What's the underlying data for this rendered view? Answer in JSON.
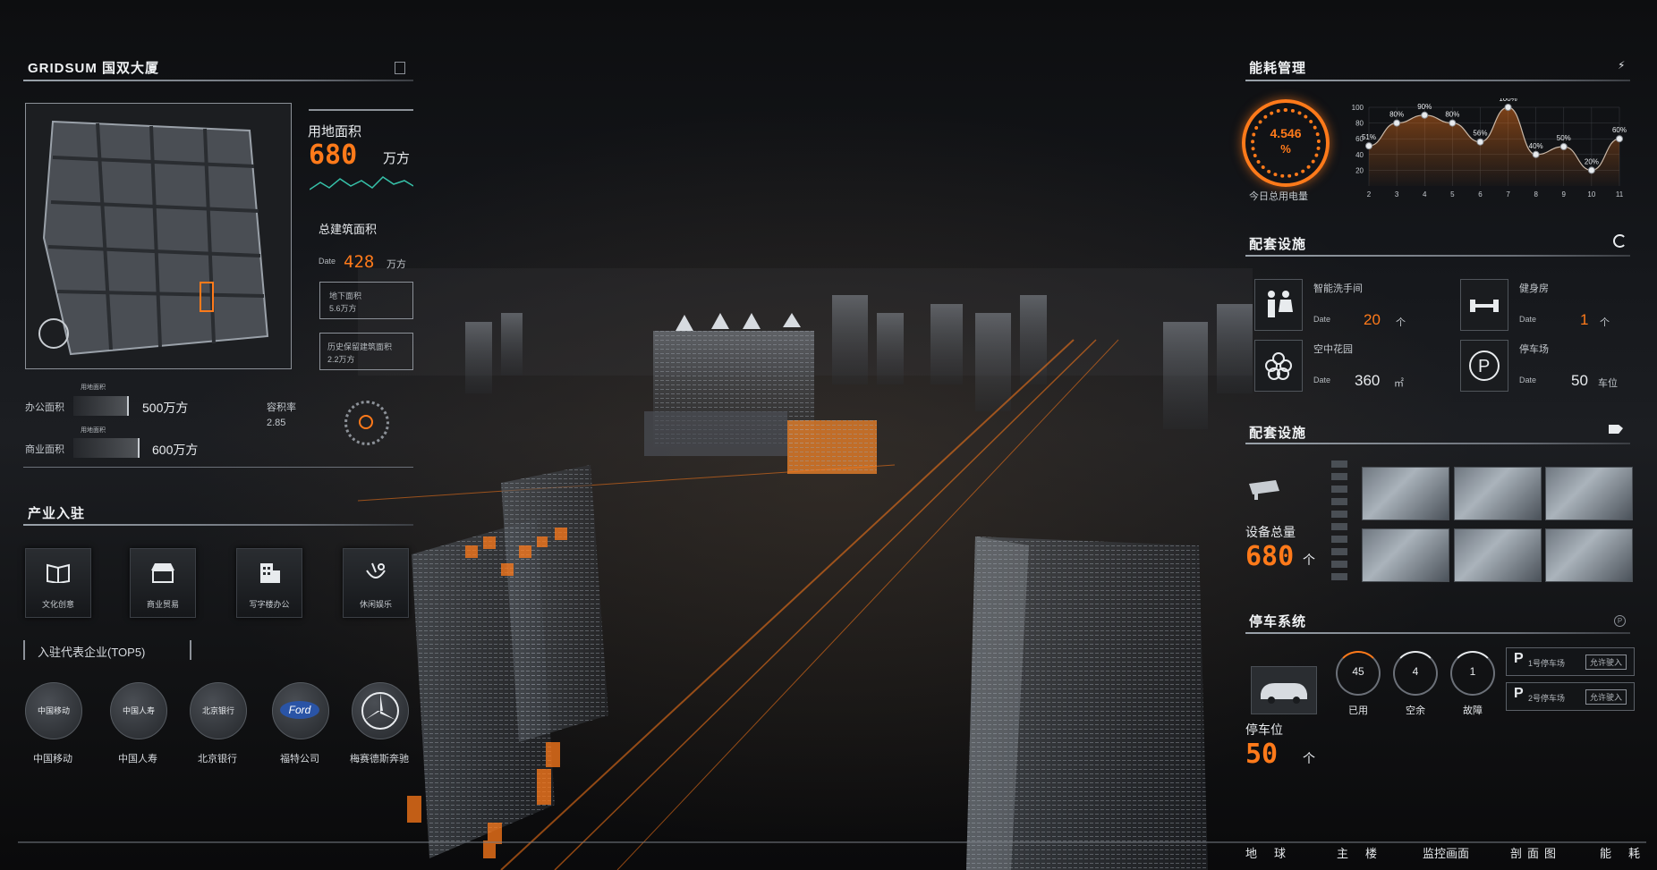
{
  "header": {
    "title": "GRIDSUM 国双大厦"
  },
  "land": {
    "label": "用地面积",
    "value": "680",
    "unit": "万方",
    "build_label": "总建筑面积",
    "date_label": "Date",
    "build_value": "428",
    "build_unit": "万方",
    "underground_label": "地下面积",
    "underground_value": "5.6万方",
    "heritage_label": "历史保留建筑面积",
    "heritage_value": "2.2万方"
  },
  "areas": {
    "office_label": "办公面积",
    "office_value": "500万方",
    "office_caption": "用地面积",
    "commerce_label": "商业面积",
    "commerce_value": "600万方",
    "commerce_caption": "用地面积",
    "plot_ratio_label": "容积率",
    "plot_ratio_value": "2.85"
  },
  "industry": {
    "title": "产业入驻",
    "tiles": [
      {
        "label": "文化创意",
        "icon": "book-icon"
      },
      {
        "label": "商业贸易",
        "icon": "store-icon"
      },
      {
        "label": "写字楼办公",
        "icon": "building-icon"
      },
      {
        "label": "休闲娱乐",
        "icon": "leisure-icon"
      }
    ],
    "top5_title": "入驻代表企业(TOP5)",
    "companies": [
      {
        "name": "中国移动",
        "logo": "中国移动"
      },
      {
        "name": "中国人寿",
        "logo": "中国人寿"
      },
      {
        "name": "北京银行",
        "logo": "北京银行"
      },
      {
        "name": "福特公司",
        "logo": "Ford"
      },
      {
        "name": "梅赛德斯奔驰",
        "logo": ""
      }
    ]
  },
  "energy": {
    "title": "能耗管理",
    "gauge_value": "4.546",
    "gauge_unit": "%",
    "gauge_caption": "今日总用电量",
    "accent": "#ff7a1a"
  },
  "chart_data": {
    "type": "area",
    "x": [
      2,
      3,
      4,
      5,
      6,
      7,
      8,
      9,
      10,
      11
    ],
    "values": [
      51,
      80,
      90,
      80,
      56,
      100,
      40,
      50,
      20,
      60
    ],
    "labels": [
      "51%",
      "80%",
      "90%",
      "80%",
      "56%",
      "100%",
      "40%",
      "50%",
      "20%",
      "60%"
    ],
    "yticks": [
      20,
      40,
      60,
      80,
      100
    ],
    "ylim": [
      0,
      100
    ]
  },
  "facilities": {
    "title": "配套设施",
    "date_label": "Date",
    "items": [
      {
        "name": "智能洗手间",
        "value": "20",
        "unit": "个",
        "icon": "restroom-icon"
      },
      {
        "name": "健身房",
        "value": "1",
        "unit": "个",
        "icon": "dumbbell-icon"
      },
      {
        "name": "空中花园",
        "value": "360",
        "unit": "㎡",
        "icon": "flower-icon"
      },
      {
        "name": "停车场",
        "value": "50",
        "unit": "车位",
        "icon": "parking-icon"
      }
    ]
  },
  "monitoring": {
    "title": "配套设施",
    "total_label": "设备总量",
    "total_value": "680",
    "total_unit": "个"
  },
  "parking": {
    "title": "停车系统",
    "spaces_label": "停车位",
    "spaces_value": "50",
    "spaces_unit": "个",
    "gauges": [
      {
        "value": "45",
        "label": "已用"
      },
      {
        "value": "4",
        "label": "空余"
      },
      {
        "value": "1",
        "label": "故障"
      }
    ],
    "lots": [
      {
        "name": "1号停车场",
        "status": "允许驶入"
      },
      {
        "name": "2号停车场",
        "status": "允许驶入"
      }
    ]
  },
  "nav": {
    "items": [
      "地　球",
      "主　楼",
      "监控画面",
      "剖面图",
      "能　耗"
    ]
  }
}
